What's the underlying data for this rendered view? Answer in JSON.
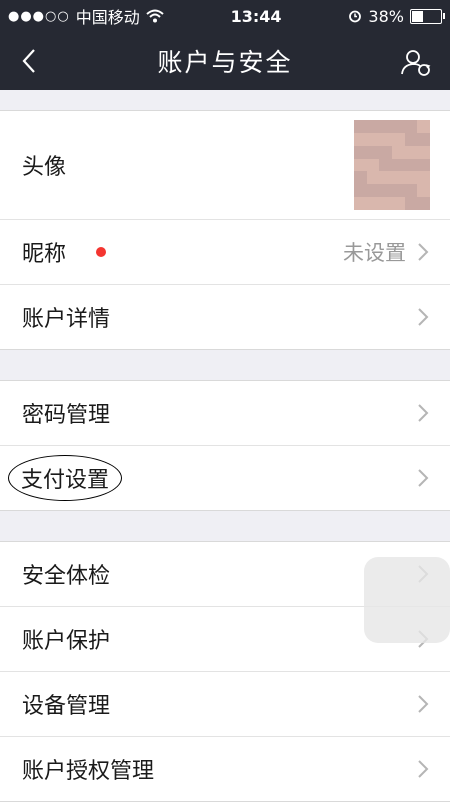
{
  "status_bar": {
    "carrier": "中国移动",
    "time": "13:44",
    "battery": "38%",
    "battery_level": 0.38
  },
  "nav": {
    "title": "账户与安全",
    "back_icon": "chevron-left-icon",
    "account_icon": "user-switch-icon"
  },
  "groups": [
    {
      "rows": [
        {
          "label": "头像",
          "type": "avatar"
        },
        {
          "label": "昵称",
          "value": "未设置",
          "badge": "red-dot"
        },
        {
          "label": "账户详情"
        }
      ]
    },
    {
      "rows": [
        {
          "label": "密码管理"
        },
        {
          "label": "支付设置",
          "circled": true
        }
      ]
    },
    {
      "rows": [
        {
          "label": "安全体检"
        },
        {
          "label": "账户保护"
        },
        {
          "label": "设备管理"
        },
        {
          "label": "账户授权管理"
        }
      ]
    }
  ],
  "colors": {
    "nav_bg": "#262933",
    "page_bg": "#efeff4",
    "badge_red": "#f43530"
  }
}
